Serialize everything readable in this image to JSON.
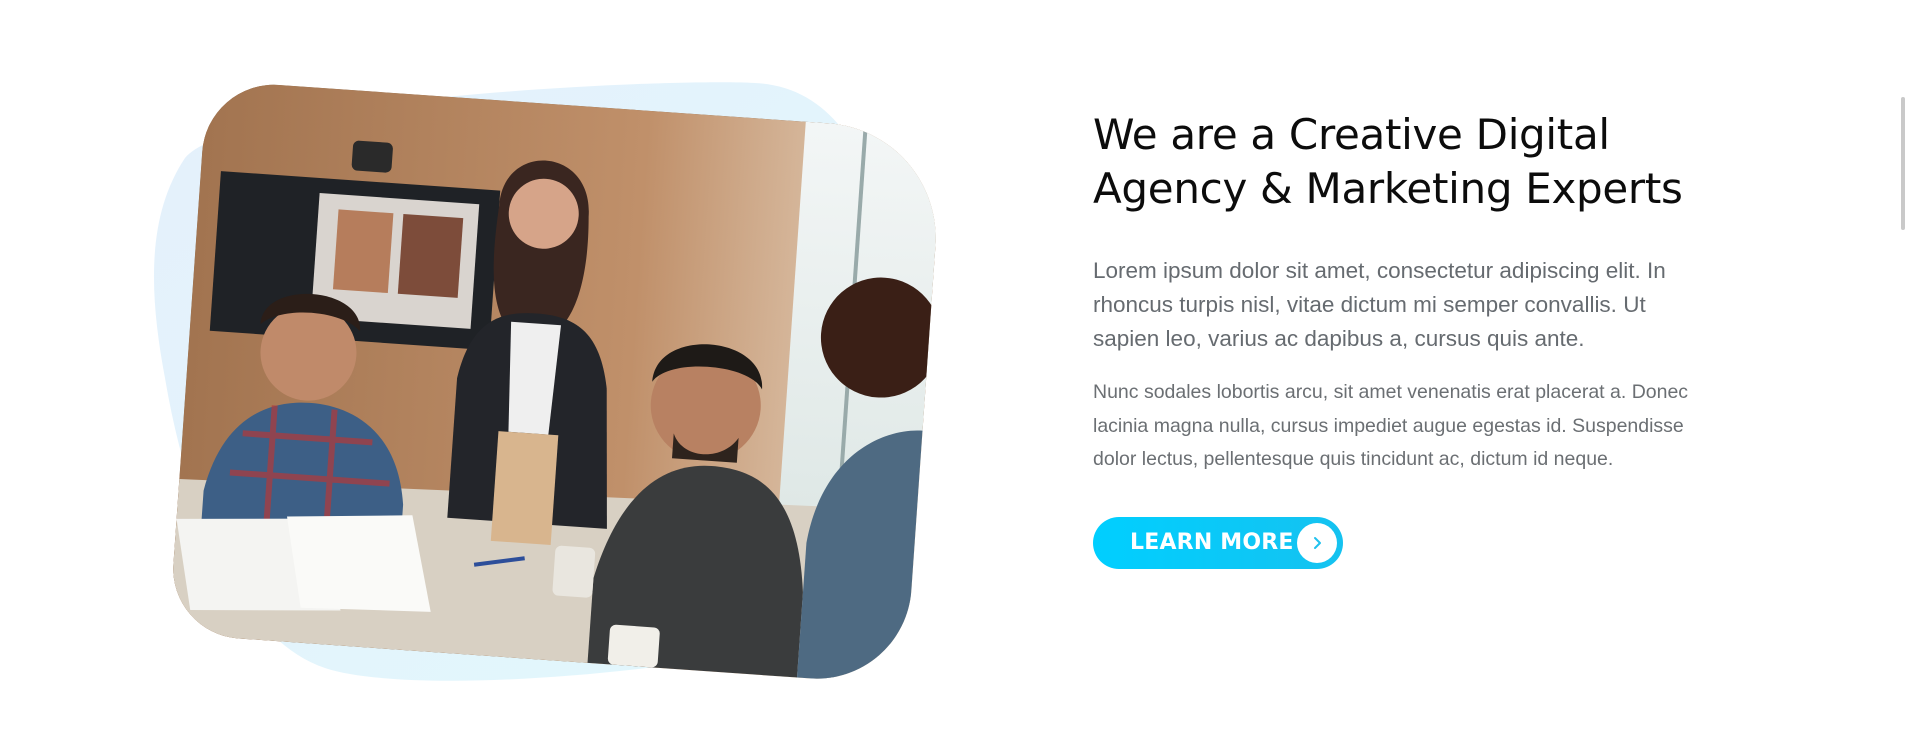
{
  "section": {
    "headline_line1": "We are a Creative Digital",
    "headline_line2": "Agency & Marketing Experts",
    "lead": "Lorem ipsum dolor sit amet, consectetur adipiscing elit. In rhoncus turpis nisl, vitae dictum mi semper convallis. Ut sapien leo, varius ac dapibus a, cursus quis ante.",
    "body": "Nunc sodales lobortis arcu, sit amet venenatis erat placerat a. Donec lacinia magna nulla, cursus impediet augue egestas id. Suspendisse dolor lectus, pellentesque quis tincidunt ac, dictum id neque.",
    "cta_label": "LEARN MORE",
    "cta_icon": "chevron-right-icon",
    "photo_subject": "team-meeting-photo"
  },
  "colors": {
    "accent": "#00cfff",
    "accent_dark": "#15c2f0",
    "blob": "#e6f5fd",
    "headline": "#0c0c0c",
    "text": "#666b70"
  }
}
